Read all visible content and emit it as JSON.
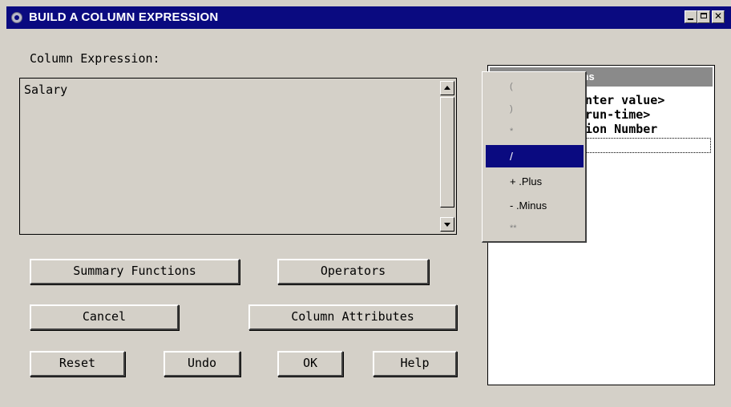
{
  "window": {
    "title": "BUILD A COLUMN EXPRESSION",
    "close_glyph": "✕"
  },
  "expression": {
    "label": "Column Expression:",
    "value": "Salary"
  },
  "buttons": {
    "summary_functions": "Summary Functions",
    "operators": "Operators",
    "cancel": "Cancel",
    "column_attributes": "Column Attributes",
    "reset": "Reset",
    "undo": "Undo",
    "ok": "OK",
    "help": "Help"
  },
  "columns_panel": {
    "header_fragment": "mns",
    "items": [
      "enter value>",
      " run-time>",
      "tion Number"
    ]
  },
  "operators_menu": {
    "items": [
      {
        "label": "(",
        "state": "dim"
      },
      {
        "label": ")",
        "state": "dim"
      },
      {
        "label": "*",
        "state": "dim"
      },
      {
        "label": "/",
        "state": "selected"
      },
      {
        "label": "+ .Plus",
        "state": "normal"
      },
      {
        "label": "- .Minus",
        "state": "normal"
      },
      {
        "label": "**",
        "state": "dim"
      }
    ]
  }
}
